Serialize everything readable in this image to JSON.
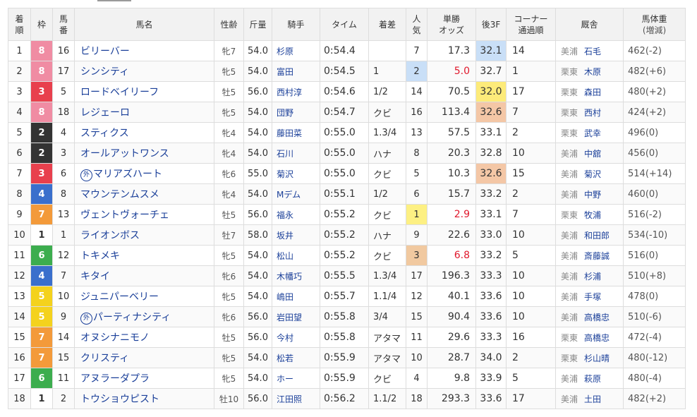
{
  "headers": {
    "rank": [
      "着",
      "順"
    ],
    "waku": "枠",
    "umaban": [
      "馬",
      "番"
    ],
    "horse": "馬名",
    "sexage": "性齢",
    "weight": "斤量",
    "jockey": "騎手",
    "time": "タイム",
    "margin": "着差",
    "popularity": [
      "人",
      "気"
    ],
    "odds": [
      "単勝",
      "オッズ"
    ],
    "last3f": "後3F",
    "corner": [
      "コーナー",
      "通過順"
    ],
    "trainer": "厩舎",
    "body_weight": [
      "馬体重",
      "(増減)"
    ]
  },
  "colors": {
    "waku": {
      "1": {
        "bg": "#ffffff",
        "fg": "#333333"
      },
      "2": {
        "bg": "#333333",
        "fg": "#ffffff"
      },
      "3": {
        "bg": "#e8404d",
        "fg": "#ffffff"
      },
      "4": {
        "bg": "#3a6fcc",
        "fg": "#ffffff"
      },
      "5": {
        "bg": "#f4d21d",
        "fg": "#ffffff"
      },
      "6": {
        "bg": "#3cad4e",
        "fg": "#ffffff"
      },
      "7": {
        "bg": "#f39a3a",
        "fg": "#ffffff"
      },
      "8": {
        "bg": "#f08ca3",
        "fg": "#ffffff"
      }
    },
    "pop_highlight": {
      "1": "#fdf083",
      "2": "#c9dff7",
      "3": "#f1c9a0"
    },
    "last3f_highlight": {
      "1": "#fdeb7a",
      "2": "#c9dff7",
      "3": "#f4c7a6"
    },
    "horse_link": "#1a3f99",
    "odds_red": "#e0182c"
  },
  "foreign_mark": "外",
  "rows": [
    {
      "rank": "1",
      "waku": "8",
      "umaban": "16",
      "horse": "ビリーバー",
      "foreign": false,
      "sexage": "牝7",
      "weight": "54.0",
      "jockey": "杉原",
      "time": "0:54.4",
      "margin": "",
      "pop": "7",
      "odds": "17.3",
      "last3f": "32.1",
      "l3f_rank": 2,
      "corner": "14",
      "loc": "美浦",
      "trainer": "石毛",
      "bw": "462(-2)"
    },
    {
      "rank": "2",
      "waku": "8",
      "umaban": "17",
      "horse": "シンシティ",
      "foreign": false,
      "sexage": "牝5",
      "weight": "54.0",
      "jockey": "富田",
      "time": "0:54.5",
      "margin": "1",
      "pop": "2",
      "odds": "5.0",
      "last3f": "32.7",
      "l3f_rank": 0,
      "corner": "1",
      "loc": "栗東",
      "trainer": "木原",
      "bw": "482(+6)"
    },
    {
      "rank": "3",
      "waku": "3",
      "umaban": "5",
      "horse": "ロードベイリーフ",
      "foreign": false,
      "sexage": "牡5",
      "weight": "56.0",
      "jockey": "西村淳",
      "time": "0:54.6",
      "margin": "1/2",
      "pop": "14",
      "odds": "70.5",
      "last3f": "32.0",
      "l3f_rank": 1,
      "corner": "17",
      "loc": "栗東",
      "trainer": "森田",
      "bw": "480(+2)"
    },
    {
      "rank": "4",
      "waku": "8",
      "umaban": "18",
      "horse": "レジェーロ",
      "foreign": false,
      "sexage": "牝5",
      "weight": "54.0",
      "jockey": "団野",
      "time": "0:54.7",
      "margin": "クビ",
      "pop": "16",
      "odds": "113.4",
      "last3f": "32.6",
      "l3f_rank": 3,
      "corner": "7",
      "loc": "栗東",
      "trainer": "西村",
      "bw": "424(+2)"
    },
    {
      "rank": "5",
      "waku": "2",
      "umaban": "4",
      "horse": "スティクス",
      "foreign": false,
      "sexage": "牝4",
      "weight": "54.0",
      "jockey": "藤田菜",
      "time": "0:55.0",
      "margin": "1.3/4",
      "pop": "13",
      "odds": "57.5",
      "last3f": "33.1",
      "l3f_rank": 0,
      "corner": "2",
      "loc": "栗東",
      "trainer": "武幸",
      "bw": "496(0)"
    },
    {
      "rank": "6",
      "waku": "2",
      "umaban": "3",
      "horse": "オールアットワンス",
      "foreign": false,
      "sexage": "牝4",
      "weight": "54.0",
      "jockey": "石川",
      "time": "0:55.0",
      "margin": "ハナ",
      "pop": "8",
      "odds": "20.3",
      "last3f": "32.8",
      "l3f_rank": 0,
      "corner": "10",
      "loc": "美浦",
      "trainer": "中舘",
      "bw": "456(0)"
    },
    {
      "rank": "7",
      "waku": "3",
      "umaban": "6",
      "horse": "マリアズハート",
      "foreign": true,
      "sexage": "牝6",
      "weight": "55.0",
      "jockey": "菊沢",
      "time": "0:55.0",
      "margin": "クビ",
      "pop": "5",
      "odds": "10.3",
      "last3f": "32.6",
      "l3f_rank": 3,
      "corner": "15",
      "loc": "美浦",
      "trainer": "菊沢",
      "bw": "514(+14)"
    },
    {
      "rank": "8",
      "waku": "4",
      "umaban": "8",
      "horse": "マウンテンムスメ",
      "foreign": false,
      "sexage": "牝4",
      "weight": "54.0",
      "jockey": "Mデム",
      "time": "0:55.1",
      "margin": "1/2",
      "pop": "6",
      "odds": "15.7",
      "last3f": "33.2",
      "l3f_rank": 0,
      "corner": "2",
      "loc": "美浦",
      "trainer": "中野",
      "bw": "460(0)"
    },
    {
      "rank": "9",
      "waku": "7",
      "umaban": "13",
      "horse": "ヴェントヴォーチェ",
      "foreign": false,
      "sexage": "牡5",
      "weight": "56.0",
      "jockey": "福永",
      "time": "0:55.2",
      "margin": "クビ",
      "pop": "1",
      "odds": "2.9",
      "last3f": "33.1",
      "l3f_rank": 0,
      "corner": "7",
      "loc": "栗東",
      "trainer": "牧浦",
      "bw": "516(-2)"
    },
    {
      "rank": "10",
      "waku": "1",
      "umaban": "1",
      "horse": "ライオンボス",
      "foreign": false,
      "sexage": "牡7",
      "weight": "58.0",
      "jockey": "坂井",
      "time": "0:55.2",
      "margin": "ハナ",
      "pop": "9",
      "odds": "22.6",
      "last3f": "33.0",
      "l3f_rank": 0,
      "corner": "10",
      "loc": "美浦",
      "trainer": "和田郎",
      "bw": "534(-10)"
    },
    {
      "rank": "11",
      "waku": "6",
      "umaban": "12",
      "horse": "トキメキ",
      "foreign": false,
      "sexage": "牝5",
      "weight": "54.0",
      "jockey": "松山",
      "time": "0:55.2",
      "margin": "クビ",
      "pop": "3",
      "odds": "6.8",
      "last3f": "33.2",
      "l3f_rank": 0,
      "corner": "5",
      "loc": "美浦",
      "trainer": "斎藤誠",
      "bw": "516(0)"
    },
    {
      "rank": "12",
      "waku": "4",
      "umaban": "7",
      "horse": "キタイ",
      "foreign": false,
      "sexage": "牝6",
      "weight": "54.0",
      "jockey": "木幡巧",
      "time": "0:55.5",
      "margin": "1.3/4",
      "pop": "17",
      "odds": "196.3",
      "last3f": "33.3",
      "l3f_rank": 0,
      "corner": "10",
      "loc": "美浦",
      "trainer": "杉浦",
      "bw": "510(+8)"
    },
    {
      "rank": "13",
      "waku": "5",
      "umaban": "10",
      "horse": "ジュニパーベリー",
      "foreign": false,
      "sexage": "牝5",
      "weight": "54.0",
      "jockey": "嶋田",
      "time": "0:55.7",
      "margin": "1.1/4",
      "pop": "12",
      "odds": "40.1",
      "last3f": "33.6",
      "l3f_rank": 0,
      "corner": "10",
      "loc": "美浦",
      "trainer": "手塚",
      "bw": "478(0)"
    },
    {
      "rank": "14",
      "waku": "5",
      "umaban": "9",
      "horse": "パーティナシティ",
      "foreign": true,
      "sexage": "牝6",
      "weight": "56.0",
      "jockey": "岩田望",
      "time": "0:55.8",
      "margin": "3/4",
      "pop": "15",
      "odds": "90.4",
      "last3f": "33.6",
      "l3f_rank": 0,
      "corner": "10",
      "loc": "美浦",
      "trainer": "高橋忠",
      "bw": "510(-6)"
    },
    {
      "rank": "15",
      "waku": "7",
      "umaban": "14",
      "horse": "オヌシナニモノ",
      "foreign": false,
      "sexage": "牡5",
      "weight": "56.0",
      "jockey": "今村",
      "time": "0:55.8",
      "margin": "アタマ",
      "pop": "11",
      "odds": "29.6",
      "last3f": "33.3",
      "l3f_rank": 0,
      "corner": "16",
      "loc": "栗東",
      "trainer": "高橋忠",
      "bw": "472(-4)"
    },
    {
      "rank": "16",
      "waku": "7",
      "umaban": "15",
      "horse": "クリスティ",
      "foreign": false,
      "sexage": "牝5",
      "weight": "54.0",
      "jockey": "松若",
      "time": "0:55.9",
      "margin": "アタマ",
      "pop": "10",
      "odds": "28.7",
      "last3f": "34.0",
      "l3f_rank": 0,
      "corner": "2",
      "loc": "栗東",
      "trainer": "杉山晴",
      "bw": "480(-12)"
    },
    {
      "rank": "17",
      "waku": "6",
      "umaban": "11",
      "horse": "アヌラーダプラ",
      "foreign": false,
      "sexage": "牝5",
      "weight": "54.0",
      "jockey": "ホー",
      "time": "0:55.9",
      "margin": "クビ",
      "pop": "4",
      "odds": "9.8",
      "last3f": "33.9",
      "l3f_rank": 0,
      "corner": "5",
      "loc": "美浦",
      "trainer": "萩原",
      "bw": "480(-4)"
    },
    {
      "rank": "18",
      "waku": "1",
      "umaban": "2",
      "horse": "トウショウピスト",
      "foreign": false,
      "sexage": "牡10",
      "weight": "56.0",
      "jockey": "江田照",
      "time": "0:56.2",
      "margin": "1.1/2",
      "pop": "18",
      "odds": "293.3",
      "last3f": "33.6",
      "l3f_rank": 0,
      "corner": "17",
      "loc": "美浦",
      "trainer": "土田",
      "bw": "482(+2)"
    }
  ]
}
